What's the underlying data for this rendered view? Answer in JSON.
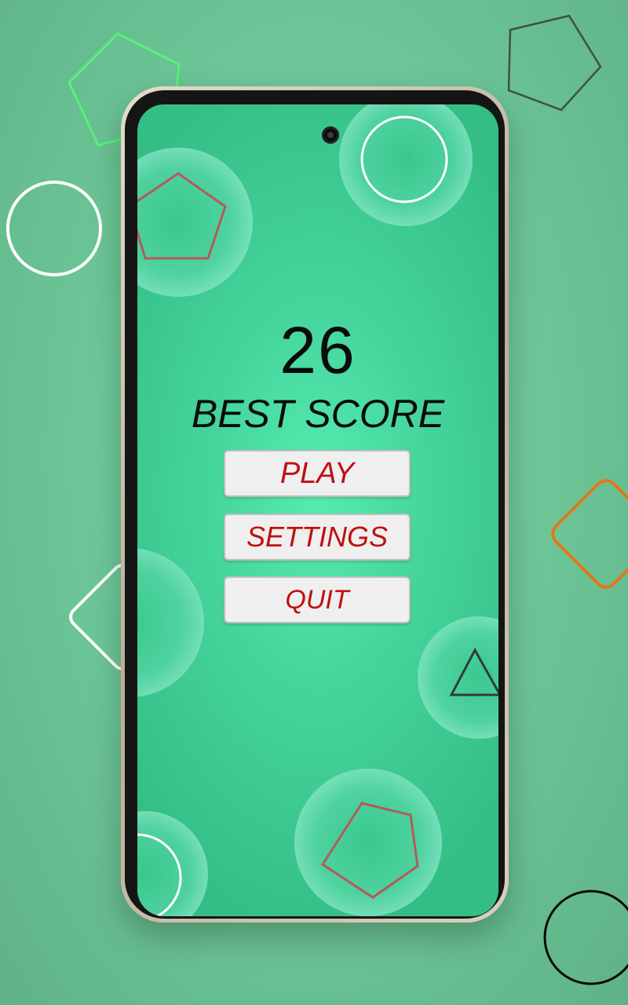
{
  "game": {
    "score": "26",
    "best_score_label": "BEST SCORE"
  },
  "menu": {
    "play_label": "PLAY",
    "settings_label": "SETTINGS",
    "quit_label": "QUIT"
  },
  "colors": {
    "button_text": "#c01010",
    "button_bg": "#efefef",
    "screen_green": "#44d49b",
    "background_green": "#6cc596"
  },
  "icons": {
    "background": [
      "pentagon-outline-icon",
      "circle-outline-icon",
      "diamond-outline-icon"
    ],
    "screen": [
      "circle-bubble-icon",
      "pentagon-bubble-icon",
      "triangle-bubble-icon",
      "diamond-bubble-icon"
    ]
  }
}
